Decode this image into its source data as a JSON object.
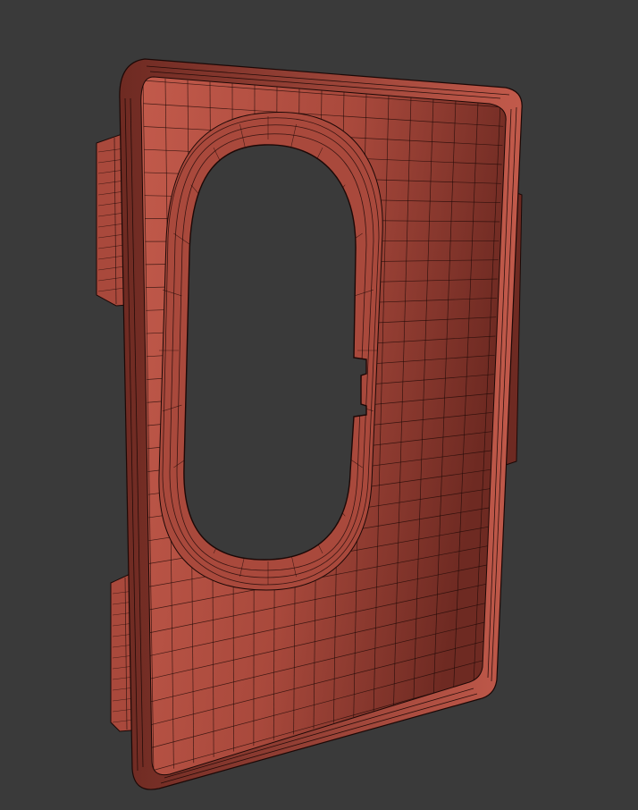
{
  "scene": {
    "subject": "wireframe-mesh-case-frame",
    "colors": {
      "background": "#3a3a3a",
      "surface": "#a9493c",
      "surface_light": "#c25a4b",
      "surface_dark": "#6e2a22",
      "surface_shadow": "#4d1d18",
      "wire": "#1c0806",
      "hole": "#3a3a3a"
    }
  }
}
